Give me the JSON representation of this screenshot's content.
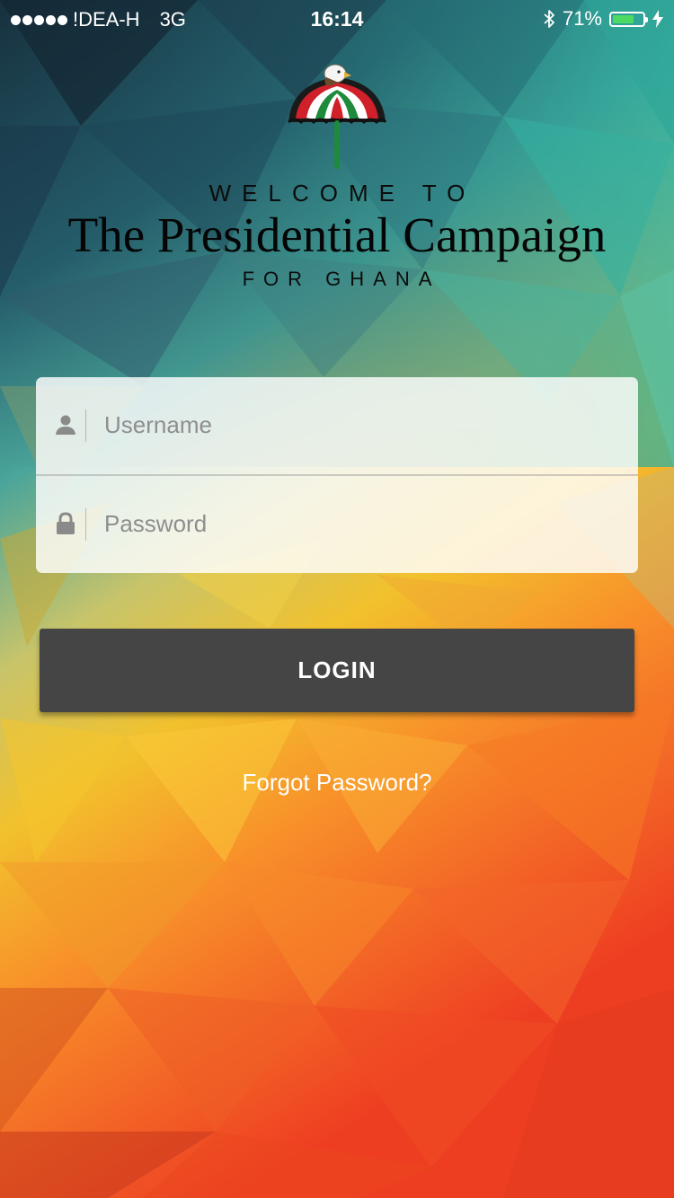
{
  "status_bar": {
    "carrier": "!DEA-H",
    "network": "3G",
    "time": "16:14",
    "battery_percent": "71%",
    "battery_level": 0.71,
    "battery_color": "#4cd964",
    "bluetooth_icon": "bluetooth-icon",
    "charging_icon": "charging-bolt-icon"
  },
  "header": {
    "logo_icon": "umbrella-eagle-logo",
    "welcome": "WELCOME TO",
    "title": "The Presidential Campaign",
    "subtitle": "FOR GHANA"
  },
  "login_form": {
    "username_placeholder": "Username",
    "username_value": "",
    "username_icon": "user-icon",
    "password_placeholder": "Password",
    "password_value": "",
    "password_icon": "lock-icon",
    "login_label": "LOGIN",
    "forgot_label": "Forgot Password?"
  },
  "colors": {
    "login_button": "#454545",
    "logo_red": "#d0202a",
    "logo_green": "#1e8a3c"
  }
}
